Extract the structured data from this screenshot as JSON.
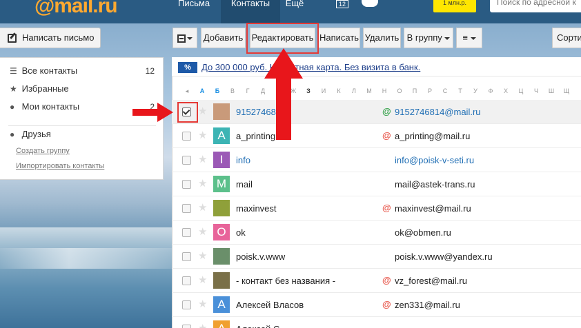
{
  "topbar": {
    "logo": "@mail.ru",
    "nav": {
      "letters": "Письма",
      "contacts": "Контакты",
      "more": "Ещё"
    },
    "calendar_day": "12",
    "million_badge": "1 млн.р.",
    "search_placeholder": "Поиск по адресной к"
  },
  "compose": {
    "label": "Написать письмо"
  },
  "sidebar": {
    "all_contacts": {
      "label": "Все контакты",
      "count": "12"
    },
    "favorites": {
      "label": "Избранные"
    },
    "my_contacts": {
      "label": "Мои контакты",
      "count": "2"
    },
    "friends": {
      "label": "Друзья"
    },
    "create_group": "Создать группу",
    "import_contacts": "Импортировать контакты"
  },
  "toolbar": {
    "add": "Добавить",
    "edit": "Редактировать",
    "write": "Написать",
    "delete": "Удалить",
    "to_group": "В группу",
    "more": "≡",
    "sort": "Сорти"
  },
  "ad": {
    "badge": "%",
    "text": "До 300 000 руб. Кредитная карта. Без визита в банк."
  },
  "alphabet": [
    "◂",
    "А",
    "Б",
    "В",
    "Г",
    "Д",
    "Е",
    "Ж",
    "З",
    "И",
    "К",
    "Л",
    "М",
    "Н",
    "О",
    "П",
    "Р",
    "С",
    "Т",
    "У",
    "Ф",
    "Х",
    "Ц",
    "Ч",
    "Ш",
    "Щ"
  ],
  "contacts": [
    {
      "name": "915274681",
      "email": "9152746814@mail.ru",
      "avatar_letter": "",
      "avatar_color": "#c99a7a",
      "selected": true,
      "mail_icon": "green",
      "link": true
    },
    {
      "name": "a_printing",
      "email": "a_printing@mail.ru",
      "avatar_letter": "A",
      "avatar_color": "#3cb4b4",
      "selected": false,
      "mail_icon": "red",
      "link": false
    },
    {
      "name": "info",
      "email": "info@poisk-v-seti.ru",
      "avatar_letter": "I",
      "avatar_color": "#9b59b6",
      "selected": false,
      "mail_icon": "",
      "link": true
    },
    {
      "name": "mail",
      "email": "mail@astek-trans.ru",
      "avatar_letter": "M",
      "avatar_color": "#5cc08b",
      "selected": false,
      "mail_icon": "",
      "link": false
    },
    {
      "name": "maxinvest",
      "email": "maxinvest@mail.ru",
      "avatar_letter": "",
      "avatar_color": "#8fa03a",
      "selected": false,
      "mail_icon": "red",
      "link": false
    },
    {
      "name": "ok",
      "email": "ok@obmen.ru",
      "avatar_letter": "O",
      "avatar_color": "#e8649a",
      "selected": false,
      "mail_icon": "",
      "link": false
    },
    {
      "name": "poisk.v.www",
      "email": "poisk.v.www@yandex.ru",
      "avatar_letter": "",
      "avatar_color": "#6a8f6a",
      "selected": false,
      "mail_icon": "",
      "link": false
    },
    {
      "name": "- контакт без названия -",
      "email": "vz_forest@mail.ru",
      "avatar_letter": "",
      "avatar_color": "#7a7048",
      "selected": false,
      "mail_icon": "red",
      "link": false
    },
    {
      "name": "Алексей Власов",
      "email": "zen331@mail.ru",
      "avatar_letter": "A",
      "avatar_color": "#4a90d9",
      "selected": false,
      "mail_icon": "red",
      "link": false
    },
    {
      "name": "Алексей С",
      "email": "...",
      "avatar_letter": "A",
      "avatar_color": "#f0a030",
      "selected": false,
      "mail_icon": "",
      "link": false
    }
  ],
  "colors": {
    "topbar": "#2a5b83",
    "accent": "#168de2",
    "highlight": "#e53935",
    "logo": "#ffa930"
  }
}
